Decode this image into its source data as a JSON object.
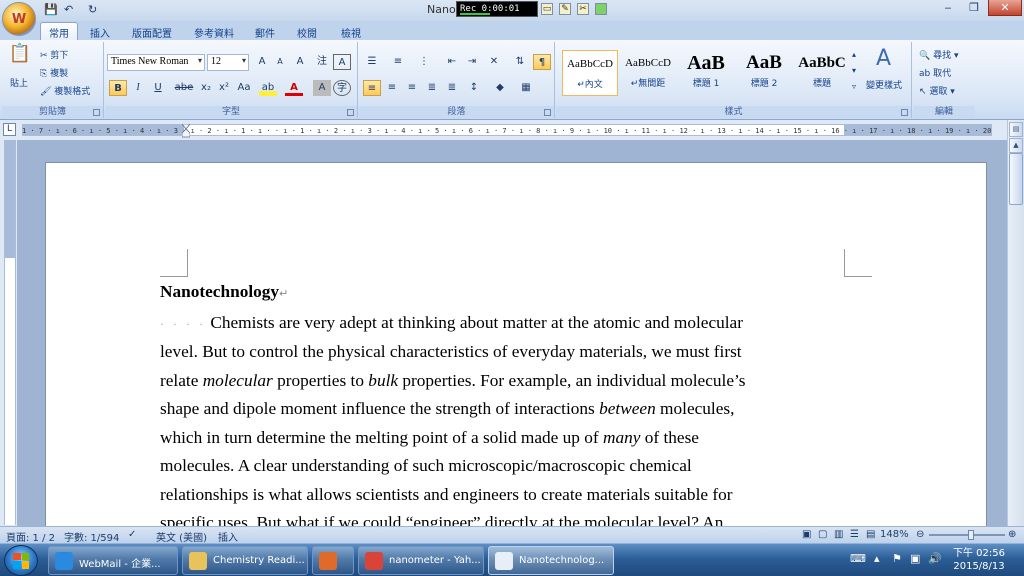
{
  "window": {
    "title": "Nano",
    "recorder_time": "Rec 0:00:01",
    "office_button": "W"
  },
  "qat": {
    "save_icon": "save-icon",
    "undo": "↶",
    "redo": "↻"
  },
  "window_controls": {
    "minimize": "‒",
    "restore": "❐",
    "close": "✕"
  },
  "tabs": [
    "常用",
    "插入",
    "版面配置",
    "參考資料",
    "郵件",
    "校閱",
    "檢視"
  ],
  "ribbon": {
    "clipboard": {
      "label": "剪貼簿",
      "paste": "貼上",
      "cut": "剪下",
      "copy": "複製",
      "format_painter": "複製格式"
    },
    "font": {
      "label": "字型",
      "name": "Times New Roman",
      "size": "12",
      "bold": "B",
      "italic": "I",
      "underline": "U",
      "strike": "abe",
      "subscript": "x₂",
      "superscript": "x²",
      "change_case": "Aa",
      "highlight": "ab",
      "font_color": "A",
      "grow": "A",
      "shrink": "A",
      "clear": "A",
      "phonetic": "注",
      "char_border": "A",
      "enclose": "字"
    },
    "paragraph": {
      "label": "段落"
    },
    "styles": {
      "label": "樣式",
      "items": [
        {
          "sample": "AaBbCcD",
          "name": "↵內文"
        },
        {
          "sample": "AaBbCcD",
          "name": "↵無間距"
        },
        {
          "sample": "AaB",
          "name": "標題 1"
        },
        {
          "sample": "AaB",
          "name": "標題 2"
        },
        {
          "sample": "AaBbC",
          "name": "標題"
        }
      ],
      "change_styles": "變更樣式"
    },
    "editing": {
      "label": "編輯",
      "find": "尋找",
      "replace": "取代",
      "select": "選取"
    }
  },
  "ruler": {
    "ticks": "1 · 7 · ı · 6 · ı · 5 · ı · 4 · ı · 3 · ı · 2 · ı · 1 · ı ·   · ı · 1 · ı · 2 · ı · 3 · ı · 4 · ı · 5 · ı · 6 · ı · 7 · ı · 8 · ı · 9 · ı · 10 · ı · 11 · ı · 12 · ı · 13 · ı · 14 · ı · 15 · ı · 16 · ı · 17 · ı · 18 · ı · 19 · ı · 20 · ı · 21 · ı · 22 · ı · 23 · ı · 24 · ı · 25 · ı · 26 · ı · 27 · ı · 28 · ı · 29 · ı · 30 · ı · 31 · ı · 32 · ı · 33 · ı · 34 · ı · 35 · ı · 36 · ı · 37 · ı · 38 · ı · 39 · ı · 40 · ı · 41 · ı · 42 · ı"
  },
  "document": {
    "heading": "Nanotechnology",
    "para_mark": "↵",
    "tab_dots": "· · · ·",
    "lines": [
      [
        {
          "t": "Chemists are very adept at thinking about matter at the atomic and molecular"
        }
      ],
      [
        {
          "t": "level. But to control the physical characteristics of everyday materials, we must first"
        }
      ],
      [
        {
          "t": "relate "
        },
        {
          "t": "molecular",
          "i": true
        },
        {
          "t": " properties to "
        },
        {
          "t": "bulk",
          "i": true
        },
        {
          "t": " properties. For example, an individual molecule’s"
        }
      ],
      [
        {
          "t": "shape and dipole moment influence the strength of interactions "
        },
        {
          "t": "between",
          "i": true
        },
        {
          "t": " molecules,"
        }
      ],
      [
        {
          "t": "which in turn determine the melting point of a solid made up of "
        },
        {
          "t": "many",
          "i": true
        },
        {
          "t": " of these"
        }
      ],
      [
        {
          "t": "molecules. A clear understanding of such microscopic/macroscopic chemical"
        }
      ],
      [
        {
          "t": "relationships is what allows scientists and engineers to create materials suitable for"
        }
      ],
      [
        {
          "t": "specific uses. But what if we could “engineer” directly at the molecular level? An"
        }
      ]
    ]
  },
  "statusbar": {
    "page": "頁面: 1 / 2",
    "words": "字數: 1/594",
    "language": "英文 (美國)",
    "mode": "插入",
    "zoom": "148%",
    "zoom_fraction": 0.55
  },
  "taskbar": {
    "items": [
      {
        "label": "WebMail - 企業...",
        "icon": "ie-icon",
        "color": "#2a8ae0"
      },
      {
        "label": "Chemistry Readi...",
        "icon": "folder-icon",
        "color": "#e8c25a"
      },
      {
        "label": "",
        "icon": "media-player-icon",
        "color": "#e06a2a"
      },
      {
        "label": "nanometer - Yah...",
        "icon": "chrome-icon",
        "color": "#d9443a"
      },
      {
        "label": "Nanotechnolog...",
        "icon": "word-icon",
        "color": "#e8eef8"
      }
    ],
    "time": "下午 02:56",
    "date": "2015/8/13"
  }
}
